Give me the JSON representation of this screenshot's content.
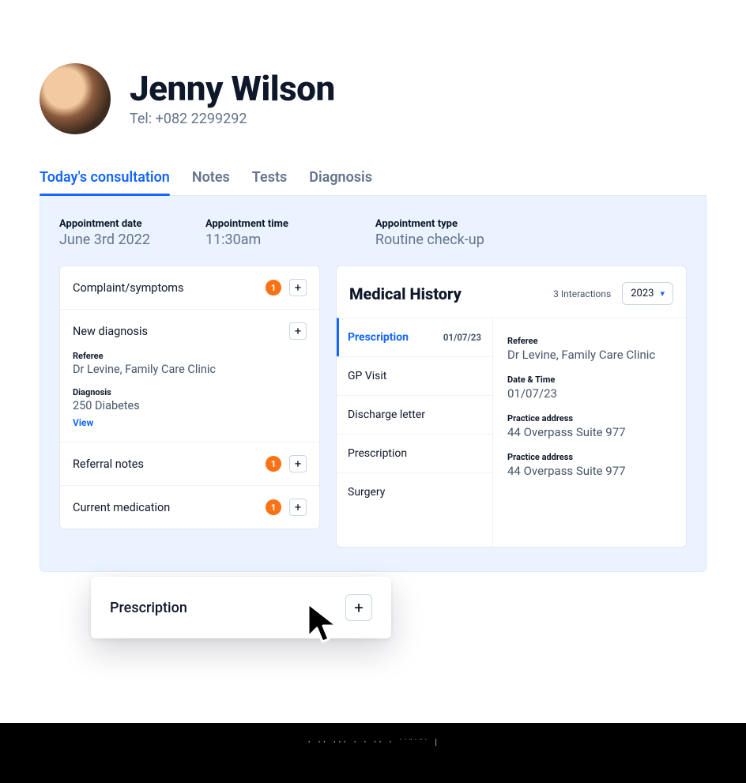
{
  "patient": {
    "name": "Jenny Wilson",
    "tel": "Tel: +082 2299292"
  },
  "tabs": {
    "t0": "Today's consultation",
    "t1": "Notes",
    "t2": "Tests",
    "t3": "Diagnosis"
  },
  "appt": {
    "date_label": "Appointment date",
    "date_value": "June 3rd 2022",
    "time_label": "Appointment time",
    "time_value": "11:30am",
    "type_label": "Appointment type",
    "type_value": "Routine check-up"
  },
  "sections": {
    "complaint": {
      "title": "Complaint/symptoms",
      "badge": "1"
    },
    "diagnosis": {
      "title": "New diagnosis",
      "referee_label": "Referee",
      "referee_value": "Dr Levine, Family Care Clinic",
      "diag_label": "Diagnosis",
      "diag_value": "250 Diabetes",
      "view": "View"
    },
    "referral": {
      "title": "Referral notes",
      "badge": "1"
    },
    "medication": {
      "title": "Current medication",
      "badge": "1"
    }
  },
  "history": {
    "title": "Medical History",
    "count": "3 Interactions",
    "year": "2023",
    "items": {
      "i0": {
        "label": "Prescription",
        "date": "01/07/23"
      },
      "i1": {
        "label": "GP Visit"
      },
      "i2": {
        "label": "Discharge letter"
      },
      "i3": {
        "label": "Prescription"
      },
      "i4": {
        "label": "Surgery"
      }
    },
    "detail": {
      "referee_label": "Referee",
      "referee_value": "Dr Levine, Family Care Clinic",
      "datetime_label": "Date & Time",
      "datetime_value": "01/07/23",
      "addr1_label": "Practice address",
      "addr1_value": "44 Overpass Suite 977",
      "addr2_label": "Practice address",
      "addr2_value": "44 Overpass Suite 977"
    }
  },
  "float": {
    "title": "Prescription"
  }
}
